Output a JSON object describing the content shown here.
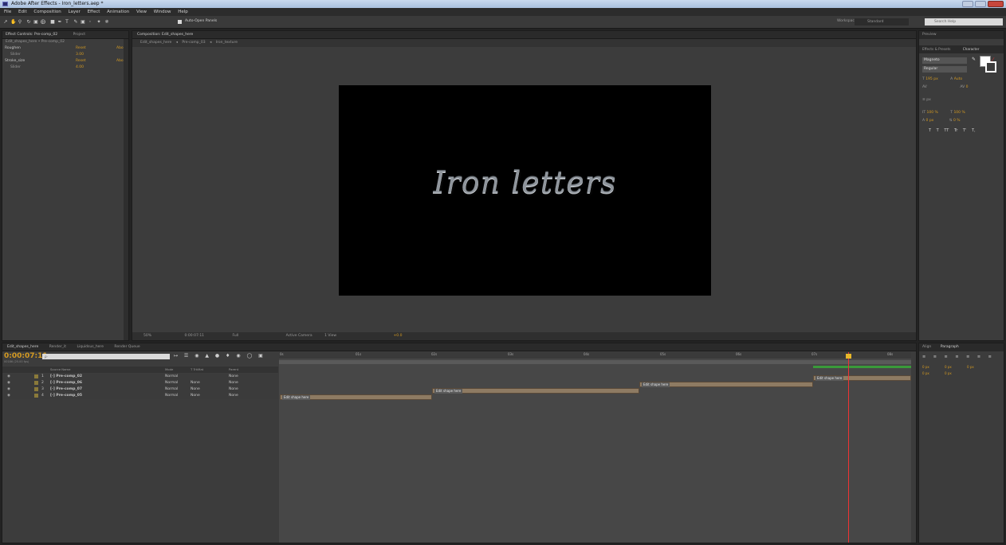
{
  "window": {
    "title": "Adobe After Effects - Iron_letters.aep *"
  },
  "menu": [
    "File",
    "Edit",
    "Composition",
    "Layer",
    "Effect",
    "Animation",
    "View",
    "Window",
    "Help"
  ],
  "toolbar": {
    "auto_open_label": "Auto-Open Panels",
    "workspace_label": "Workspace:",
    "workspace_value": "Standard",
    "search_placeholder": "Search Help"
  },
  "effect_controls": {
    "tab_label": "Effect Controls: Pre-comp_02",
    "tab2_label": "Project",
    "breadcrumb": "Edit_shapes_here • Pre-comp_02",
    "effects": [
      {
        "name": "Roughen",
        "reset": "Reset",
        "about": "Abo",
        "param": "Slider",
        "value": "3.00"
      },
      {
        "name": "Stroke_size",
        "reset": "Reset",
        "about": "Abo",
        "param": "Slider",
        "value": "4.00"
      }
    ]
  },
  "composition": {
    "tab_label": "Composition: Edit_shapes_here",
    "breadcrumbs": [
      "Edit_shapes_here",
      "Pre-comp_03",
      "Iron_texture"
    ],
    "canvas_text": "Iron letters",
    "zoom": "50%",
    "timecode": "0:00:07:11",
    "resolution": "Full",
    "camera": "Active Camera",
    "views": "1 View",
    "exposure": "+0.0"
  },
  "right_panel": {
    "preview_tab": "Preview",
    "effects_tab": "Effects & Presets",
    "character_tab": "Character",
    "font": "Magneto",
    "style": "Regular",
    "font_size": "195 px",
    "leading": "Auto",
    "tracking": "0",
    "stroke": "px",
    "v_scale": "100 %",
    "h_scale": "100 %",
    "baseline": "0 px",
    "tsume": "0 %",
    "text_styles": [
      "T",
      "T",
      "TT",
      "Tr",
      "T'",
      "T,"
    ],
    "align_tab": "Align",
    "paragraph_tab": "Paragraph",
    "para_values": [
      "0 px",
      "0 px",
      "0 px",
      "0 px",
      "0 px"
    ]
  },
  "timeline": {
    "tabs": [
      "Edit_shapes_here",
      "Render_it",
      "Liquidsus_here",
      "Render Queue"
    ],
    "timecode": "0:00:07:11",
    "fps": "00186 (25.00 fps)",
    "search_placeholder": "ρ·",
    "columns": {
      "source_name": "Source Name",
      "mode": "Mode",
      "trkmat": "T TrkMat",
      "parent": "Parent"
    },
    "layers": [
      {
        "num": "1",
        "name": "[·] Pre-comp_02",
        "mode": "Normal",
        "trkmat": "",
        "parent": "None",
        "label_color": "#8a7a3a"
      },
      {
        "num": "2",
        "name": "[·] Pre-comp_06",
        "mode": "Normal",
        "trkmat": "None",
        "parent": "None",
        "label_color": "#8a7a3a"
      },
      {
        "num": "3",
        "name": "[·] Pre-comp_07",
        "mode": "Normal",
        "trkmat": "None",
        "parent": "None",
        "label_color": "#8a7a3a"
      },
      {
        "num": "4",
        "name": "[·] Pre-comp_05",
        "mode": "Normal",
        "trkmat": "None",
        "parent": "None",
        "label_color": "#8a7a3a"
      }
    ],
    "ruler": [
      "0s",
      "01s",
      "02s",
      "03s",
      "04s",
      "05s",
      "06s",
      "07s",
      "08s"
    ],
    "bar_label": "Edit shape here"
  }
}
